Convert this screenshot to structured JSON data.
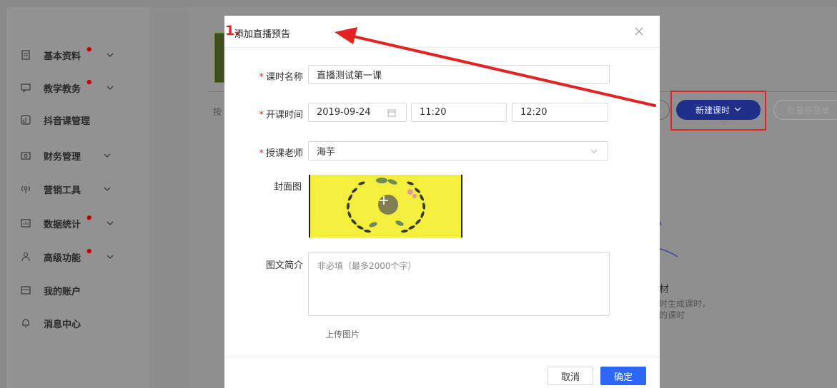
{
  "sidebar": {
    "items": [
      {
        "label": "基本资料",
        "icon": "document-icon",
        "required_dot": "•",
        "has_chevron": true
      },
      {
        "label": "教学教务",
        "icon": "chat-icon",
        "required_dot": "•",
        "has_chevron": true
      },
      {
        "label": "抖音课管理",
        "icon": "tiktok-icon",
        "required_dot": "",
        "has_chevron": false
      },
      {
        "label": "财务管理",
        "icon": "wallet-icon",
        "required_dot": "",
        "has_chevron": true
      },
      {
        "label": "营销工具",
        "icon": "broadcast-icon",
        "required_dot": "",
        "has_chevron": true
      },
      {
        "label": "数据统计",
        "icon": "chart-icon",
        "required_dot": "•",
        "has_chevron": true
      },
      {
        "label": "高级功能",
        "icon": "user-group-icon",
        "required_dot": "•",
        "has_chevron": true
      },
      {
        "label": "我的账户",
        "icon": "account-icon",
        "required_dot": "",
        "has_chevron": false
      },
      {
        "label": "消息中心",
        "icon": "bell-icon",
        "required_dot": "",
        "has_chevron": false
      }
    ]
  },
  "background": {
    "left_fragment": "按",
    "new_lesson_button": "新建课时",
    "batch_button": "批量移至单",
    "empty_title": "材",
    "empty_desc_line1": "时生成课时，",
    "empty_desc_line2": "的课时"
  },
  "annotation": {
    "step_number": "1.",
    "highlight_color": "#e52222"
  },
  "modal": {
    "title": "添加直播预告",
    "fields": {
      "lesson_name": {
        "label": "课时名称",
        "value": "直播测试第一课"
      },
      "start_time": {
        "label": "开课时间",
        "date": "2019-09-24",
        "start": "11:20",
        "end": "12:20"
      },
      "teacher": {
        "label": "授课老师",
        "value": "海芋"
      },
      "cover": {
        "label": "封面图"
      },
      "intro": {
        "label": "图文简介",
        "placeholder": "非必填（最多2000个字）"
      }
    },
    "upload_image_link": "上传图片",
    "required_mark": "*",
    "cancel_label": "取消",
    "ok_label": "确定"
  },
  "colors": {
    "primary": "#2c68f5",
    "required": "#e52222",
    "overlay": "#8a8a8a"
  }
}
